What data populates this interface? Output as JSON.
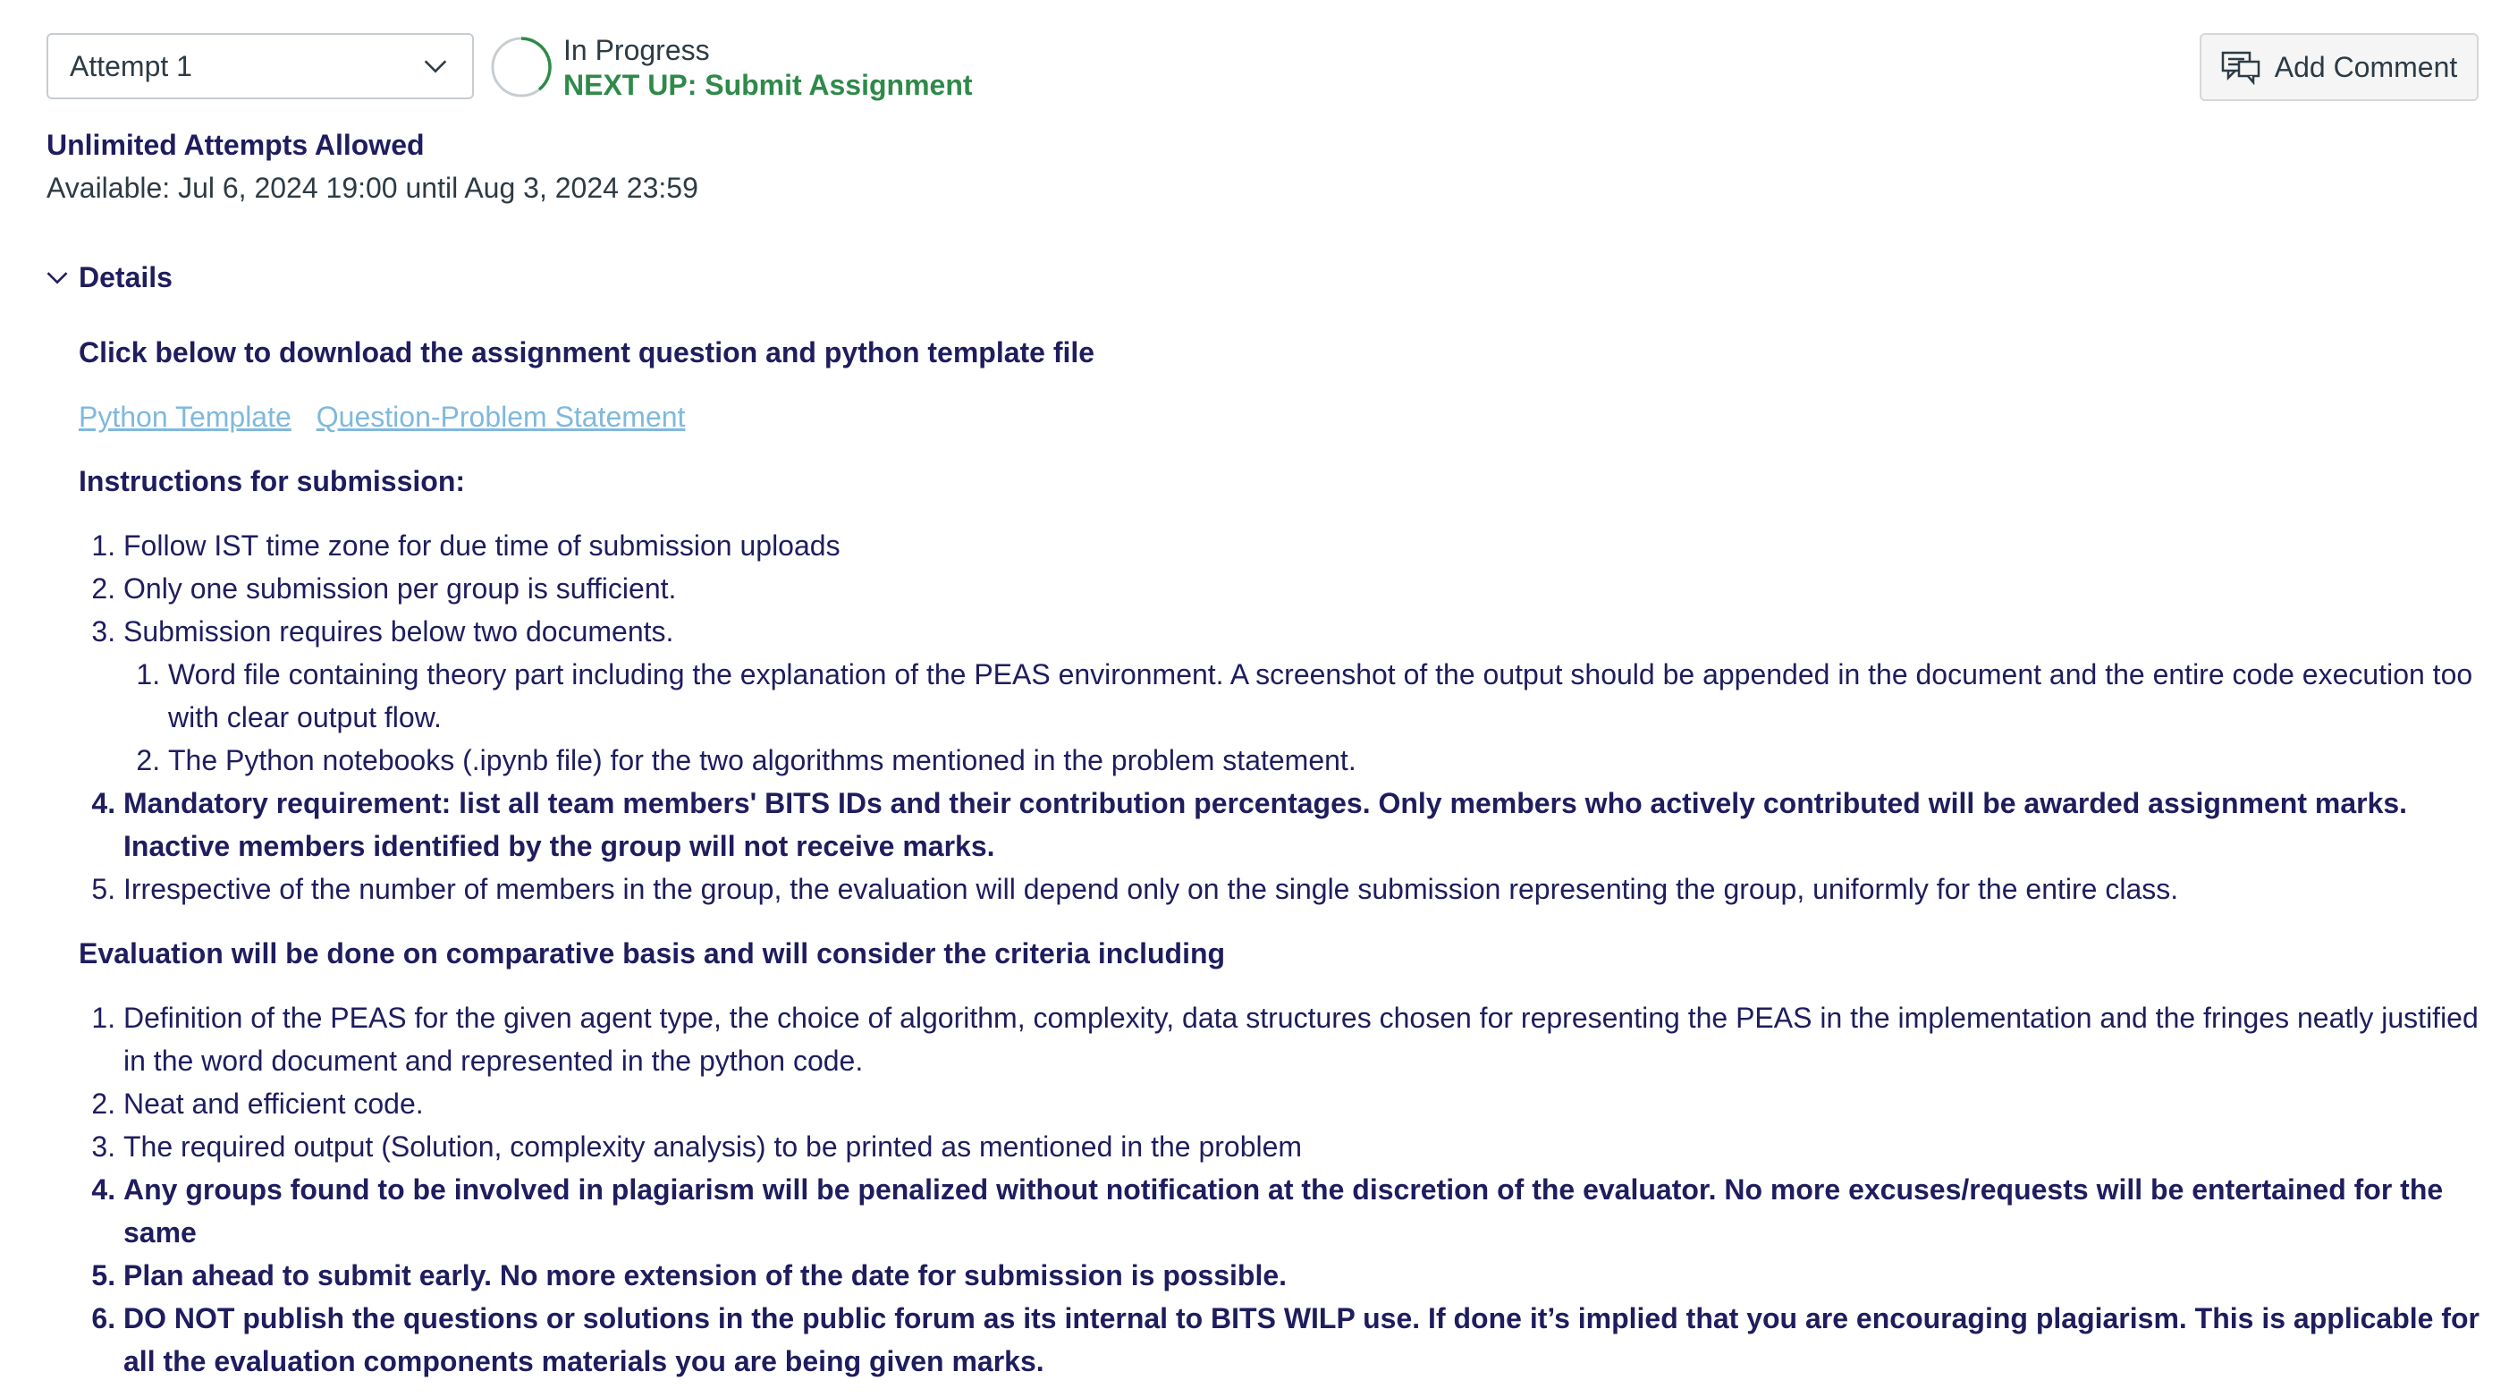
{
  "header": {
    "attempt_label": "Attempt 1",
    "status": "In Progress",
    "next_up": "NEXT UP: Submit Assignment",
    "add_comment_label": "Add Comment",
    "accent_green": "#2f8a4a"
  },
  "info": {
    "attempts_allowed": "Unlimited Attempts Allowed",
    "available": "Available: Jul 6, 2024 19:00 until Aug 3, 2024 23:59"
  },
  "details": {
    "toggle_label": "Details",
    "download_heading": "Click below to download the assignment question and python template file",
    "links": [
      "Python Template",
      "Question-Problem Statement"
    ],
    "instructions_heading": "Instructions for submission:",
    "instructions": [
      "Follow IST time zone for due time of submission uploads",
      "Only one submission per group is sufficient.",
      "Submission requires below two documents."
    ],
    "sub_instructions": [
      "Word file containing theory part including the explanation of the PEAS environment. A screenshot of the output should be appended in the document and the entire code execution too with clear output flow.",
      "The Python notebooks (.ipynb file) for the two algorithms mentioned in the problem statement."
    ],
    "instruction_4": "Mandatory requirement: list all team members' BITS IDs and their contribution percentages. Only members who actively contributed will be awarded assignment marks. Inactive members identified by the group will not receive marks.",
    "instruction_5": "Irrespective of the number of members in the group, the evaluation will depend only on the single submission representing the group, uniformly for the entire class.",
    "evaluation_heading": "Evaluation will be done on comparative basis and will consider the criteria including",
    "evaluation": [
      "Definition of the PEAS for the given agent type, the choice of algorithm, complexity, data structures chosen for representing the PEAS in the implementation and the fringes neatly justified in the word document and represented in the python code.",
      "Neat and efficient code.",
      "The required output (Solution, complexity analysis) to be printed as mentioned in the problem",
      "Any groups found to be involved in plagiarism will be penalized without notification at the discretion of the evaluator. No more excuses/requests will be entertained for the same",
      "Plan ahead to submit early. No more extension of the date for submission is possible.",
      "DO NOT publish the questions or solutions in the public forum as its internal to BITS WILP use. If done it’s implied that you are encouraging plagiarism. This is applicable for all the evaluation components materials you are being given marks."
    ]
  }
}
